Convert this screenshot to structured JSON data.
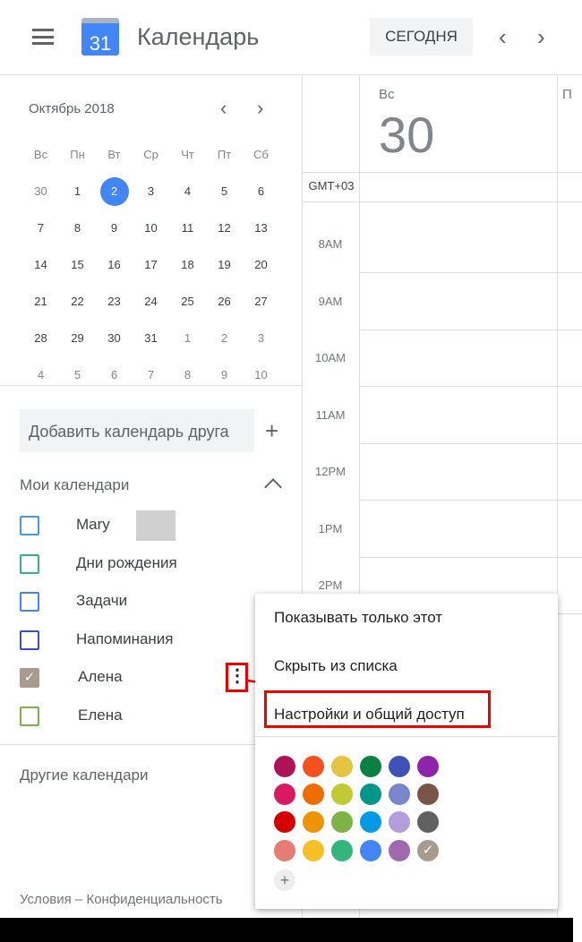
{
  "header": {
    "app_title": "Календарь",
    "logo_day": "31",
    "today_button": "СЕГОДНЯ",
    "prev": "‹",
    "next": "›"
  },
  "mini_calendar": {
    "month": "Октябрь 2018",
    "weekdays": [
      "Вс",
      "Пн",
      "Вт",
      "Ср",
      "Чт",
      "Пт",
      "Сб"
    ],
    "weeks": [
      [
        "30",
        "1",
        "2",
        "3",
        "4",
        "5",
        "6"
      ],
      [
        "7",
        "8",
        "9",
        "10",
        "11",
        "12",
        "13"
      ],
      [
        "14",
        "15",
        "16",
        "17",
        "18",
        "19",
        "20"
      ],
      [
        "21",
        "22",
        "23",
        "24",
        "25",
        "26",
        "27"
      ],
      [
        "28",
        "29",
        "30",
        "31",
        "1",
        "2",
        "3"
      ],
      [
        "4",
        "5",
        "6",
        "7",
        "8",
        "9",
        "10"
      ]
    ],
    "selected": "2"
  },
  "sidebar": {
    "add_friend": "Добавить календарь друга",
    "my_calendars": "Мои календари",
    "calendars": [
      {
        "label": "Mary",
        "color": "#4a9bd4",
        "checked": false
      },
      {
        "label": "Дни рождения",
        "color": "#33b679",
        "checked": false
      },
      {
        "label": "Задачи",
        "color": "#4285f4",
        "checked": false
      },
      {
        "label": "Напоминания",
        "color": "#3f51b5",
        "checked": false
      },
      {
        "label": "Алена",
        "color": "#a79b8e",
        "checked": true
      },
      {
        "label": "Елена",
        "color": "#7cb342",
        "checked": false
      }
    ],
    "other_calendars": "Другие календари",
    "footer_terms": "Условия",
    "footer_dash": "–",
    "footer_privacy": "Конфиденциальность"
  },
  "day_view": {
    "day_name": "Вс",
    "day_number": "30",
    "next_day_name": "П",
    "timezone": "GMT+03",
    "hours": [
      "8AM",
      "9AM",
      "10AM",
      "11AM",
      "12PM",
      "1PM",
      "2PM"
    ]
  },
  "context_menu": {
    "items": [
      "Показывать только этот",
      "Скрыть из списка",
      "Настройки и общий доступ"
    ],
    "highlighted": "Настройки и общий доступ",
    "colors": [
      [
        "#ad1457",
        "#f4511e",
        "#e4c441",
        "#0b8043",
        "#3f51b5",
        "#8e24aa"
      ],
      [
        "#d81b60",
        "#ef6c00",
        "#c0ca33",
        "#009688",
        "#7986cb",
        "#795548"
      ],
      [
        "#d50000",
        "#f09300",
        "#7cb342",
        "#039be5",
        "#b39ddb",
        "#616161"
      ],
      [
        "#e67c73",
        "#f6bf26",
        "#33b679",
        "#4285f4",
        "#9e69af",
        "#a79b8e"
      ]
    ],
    "selected_color": "#a79b8e",
    "add_color": "+"
  }
}
